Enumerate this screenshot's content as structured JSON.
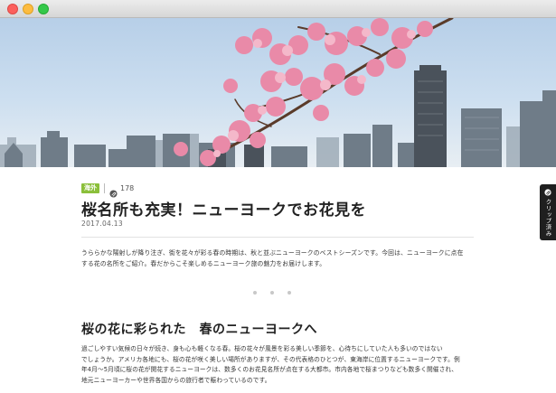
{
  "window": {
    "controls": [
      "close",
      "minimize",
      "maximize"
    ]
  },
  "hero": {
    "subject": "cherry-blossoms-over-city-skyline"
  },
  "article": {
    "category": "海外",
    "clip_count": "178",
    "title": "桜名所も充実！ニューヨークでお花見を",
    "date": "2017.04.13",
    "intro_lines": [
      "うららかな陽射しが降り注ぎ、街を花々が彩る春の時期は、秋と並ぶニューヨークのベストシーズンです。今回は、ニューヨークに点在",
      "する花の名所をご紹介。春だからこそ楽しめるニューヨーク旅の魅力をお届けします。"
    ],
    "section_title": "桜の花に彩られた　春のニューヨークへ",
    "body_lines": [
      "過ごしやすい気候の日々が続き、身も心も軽くなる春。桜の花々が風景を彩る美しい季節を、心待ちにしていた人も多いのではない",
      "でしょうか。アメリカ各地にも、桜の花が咲く美しい場所がありますが、その代表格のひとつが、東海岸に位置するニューヨークです。例",
      "年4月〜5月頃に桜の花が開花するニューヨークは、数多くのお花見名所が点在する大都市。市内各地で桜まつりなども数多く開催され、",
      "地元ニューヨーカーや世界各国からの旅行者で賑わっているのです。"
    ]
  },
  "clip_tab": {
    "label": "クリップ済み"
  },
  "colors": {
    "category_badge": "#8bbf3a",
    "clip_tab_bg": "#1f1f1f"
  },
  "icons": [
    "paperclip-icon",
    "clip-tab-icon"
  ]
}
